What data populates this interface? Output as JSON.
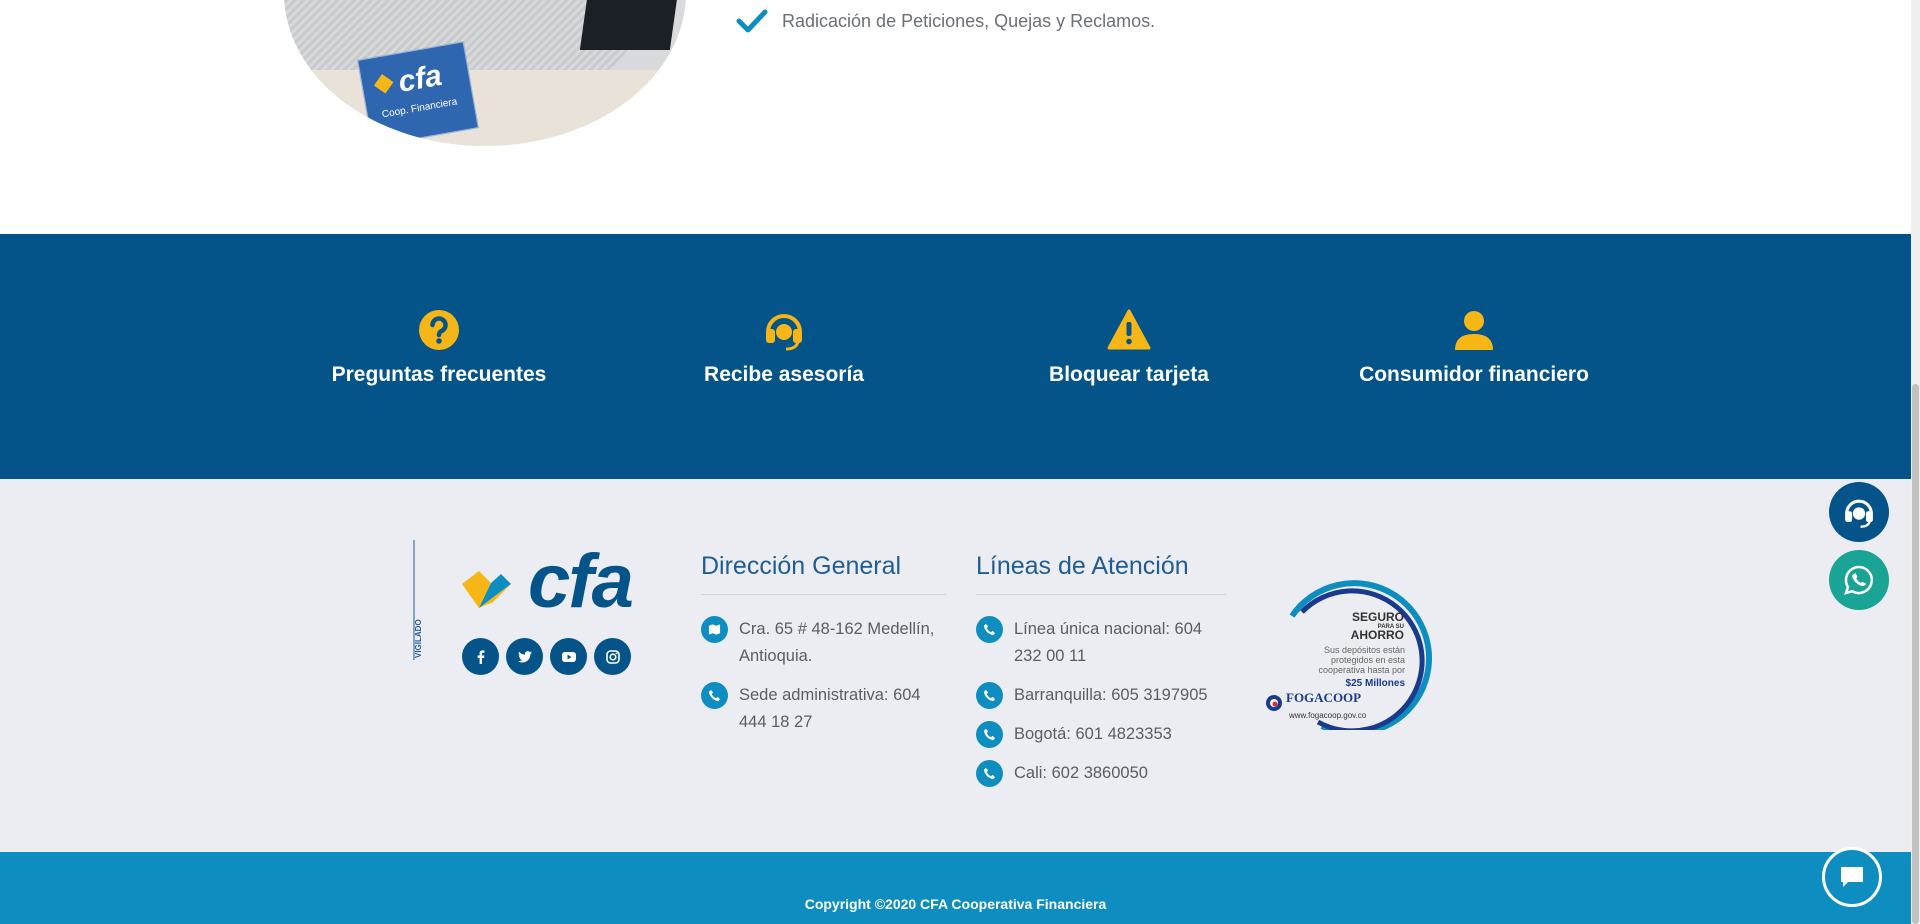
{
  "top": {
    "checklist_item": "Radicación de Peticiones, Quejas y Reclamos.",
    "card_logo": "cfa",
    "card_subtitle": "Coop. Financiera"
  },
  "features": [
    {
      "label": "Preguntas frecuentes",
      "icon": "question-circle-icon"
    },
    {
      "label": "Recibe asesoría",
      "icon": "headset-icon"
    },
    {
      "label": "Bloquear tarjeta",
      "icon": "warning-icon"
    },
    {
      "label": "Consumidor financiero",
      "icon": "user-icon"
    }
  ],
  "footer": {
    "brand": "cfa",
    "vigilado": "VIGILADO",
    "social": [
      "facebook-icon",
      "twitter-icon",
      "youtube-icon",
      "instagram-icon"
    ],
    "direccion": {
      "title": "Dirección General",
      "items": [
        {
          "icon": "map-icon",
          "text": "Cra. 65 # 48-162 Medellín, Antioquia."
        },
        {
          "icon": "phone-icon",
          "text": "Sede administrativa: 604 444 18 27"
        }
      ]
    },
    "lineas": {
      "title": "Líneas de Atención",
      "items": [
        {
          "icon": "phone-icon",
          "text": "Línea única nacional: 604 232 00 11"
        },
        {
          "icon": "phone-icon",
          "text": "Barranquilla: 605 3197905"
        },
        {
          "icon": "phone-icon",
          "text": "Bogotá: 601 4823353"
        },
        {
          "icon": "phone-icon",
          "text": "Cali: 602 3860050"
        }
      ]
    },
    "fogacoop": {
      "line1": "SEGURO",
      "line2": "PARA SU",
      "line3": "AHORRO",
      "desc1": "Sus depósitos están",
      "desc2": "protegidos en esta",
      "desc3": "cooperativa hasta por",
      "amount": "$25 Millones",
      "name": "FOGACOOP",
      "url": "www.fogacoop.gov.co"
    }
  },
  "copyright": "Copyright ©2020 CFA Cooperativa Financiera",
  "colors": {
    "navy": "#055489",
    "cyan": "#0e8ec0",
    "gold": "#f6b616",
    "whatsapp": "#1aa495",
    "footer_bg": "#ecedf2"
  }
}
